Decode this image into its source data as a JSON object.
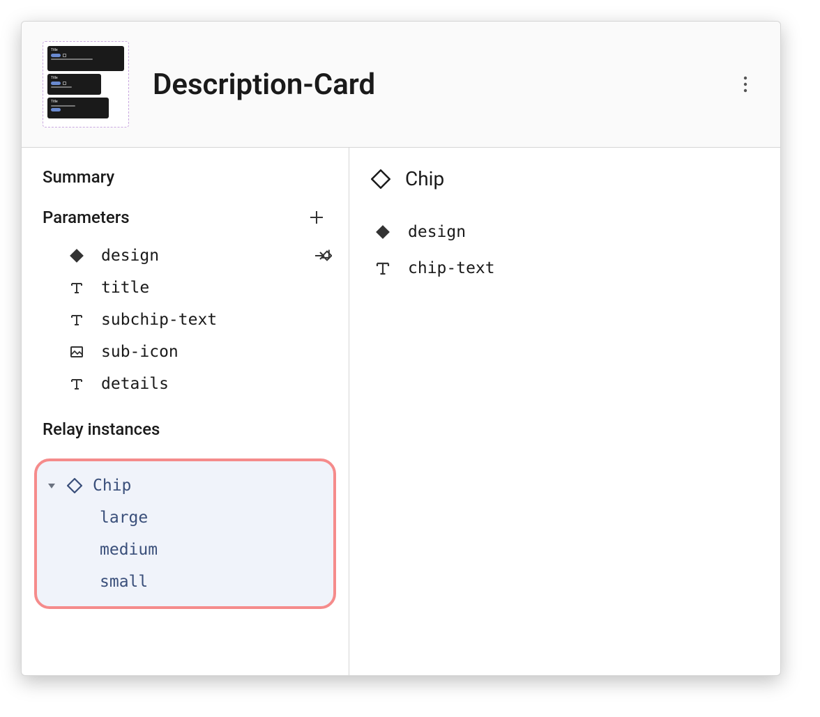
{
  "header": {
    "title": "Description-Card",
    "thumb_title": "Title"
  },
  "left": {
    "summary": "Summary",
    "parameters_label": "Parameters",
    "relay_label": "Relay instances",
    "params": [
      {
        "icon": "diamond-solid",
        "label": "design",
        "action": "assign"
      },
      {
        "icon": "text",
        "label": "title"
      },
      {
        "icon": "text",
        "label": "subchip-text"
      },
      {
        "icon": "image",
        "label": "sub-icon"
      },
      {
        "icon": "text",
        "label": "details"
      }
    ],
    "relay": {
      "name": "Chip",
      "children": [
        "large",
        "medium",
        "small"
      ]
    }
  },
  "right": {
    "title": "Chip",
    "items": [
      {
        "icon": "diamond-solid",
        "label": "design"
      },
      {
        "icon": "text",
        "label": "chip-text"
      }
    ]
  }
}
